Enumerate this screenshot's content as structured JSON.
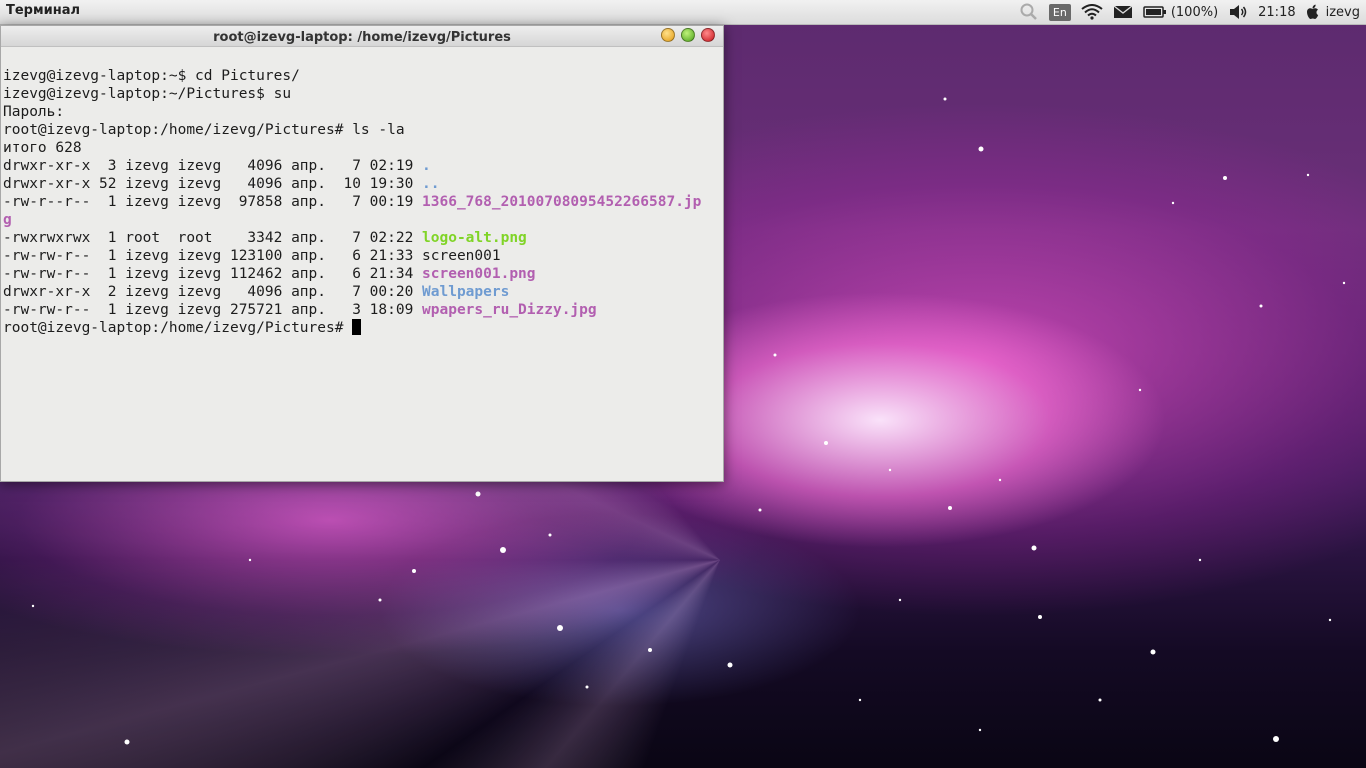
{
  "panel": {
    "app_name": "Терминал",
    "tray": {
      "search_icon": "search-icon",
      "keyboard_layout": "En",
      "wifi_icon": "wifi-icon",
      "mail_icon": "mail-icon",
      "battery_icon": "battery-icon",
      "battery_level": "(100%)",
      "volume_icon": "volume-icon",
      "clock": "21:18",
      "user_icon": "apple-icon",
      "username": "izevg"
    }
  },
  "window": {
    "title": "root@izevg-laptop: /home/izevg/Pictures",
    "buttons": [
      "minimize",
      "maximize",
      "close"
    ]
  },
  "terminal": {
    "commands": {
      "line1": "izevg@izevg-laptop:~$ cd Pictures/",
      "line2": "izevg@izevg-laptop:~/Pictures$ su",
      "line3": "Пароль:",
      "line4": "root@izevg-laptop:/home/izevg/Pictures# ls -la",
      "line5": "итого 628",
      "prompt": "root@izevg-laptop:/home/izevg/Pictures# "
    },
    "listing": [
      {
        "meta": "drwxr-xr-x  3 izevg izevg   4096 апр.   7 02:19 ",
        "name": ".",
        "kind": "dir"
      },
      {
        "meta": "drwxr-xr-x 52 izevg izevg   4096 апр.  10 19:30 ",
        "name": "..",
        "kind": "dir"
      },
      {
        "meta": "-rw-r--r--  1 izevg izevg  97858 апр.   7 00:19 ",
        "name": "1366_768_20100708095452266587.jp",
        "kind": "img"
      },
      {
        "meta": "",
        "name": "g",
        "kind": "img"
      },
      {
        "meta": "-rwxrwxrwx  1 root  root    3342 апр.   7 02:22 ",
        "name": "logo-alt.png",
        "kind": "exe"
      },
      {
        "meta": "-rw-rw-r--  1 izevg izevg 123100 апр.   6 21:33 ",
        "name": "screen001",
        "kind": "plain"
      },
      {
        "meta": "-rw-rw-r--  1 izevg izevg 112462 апр.   6 21:34 ",
        "name": "screen001.png",
        "kind": "img"
      },
      {
        "meta": "drwxr-xr-x  2 izevg izevg   4096 апр.   7 00:20 ",
        "name": "Wallpapers",
        "kind": "dir"
      },
      {
        "meta": "-rw-rw-r--  1 izevg izevg 275721 апр.   3 18:09 ",
        "name": "wpapers_ru_Dizzy.jpg",
        "kind": "img"
      }
    ]
  },
  "colors": {
    "dir": "#6f9bd1",
    "image": "#b25fb0",
    "executable": "#80d427",
    "terminal_bg": "#ececea"
  }
}
